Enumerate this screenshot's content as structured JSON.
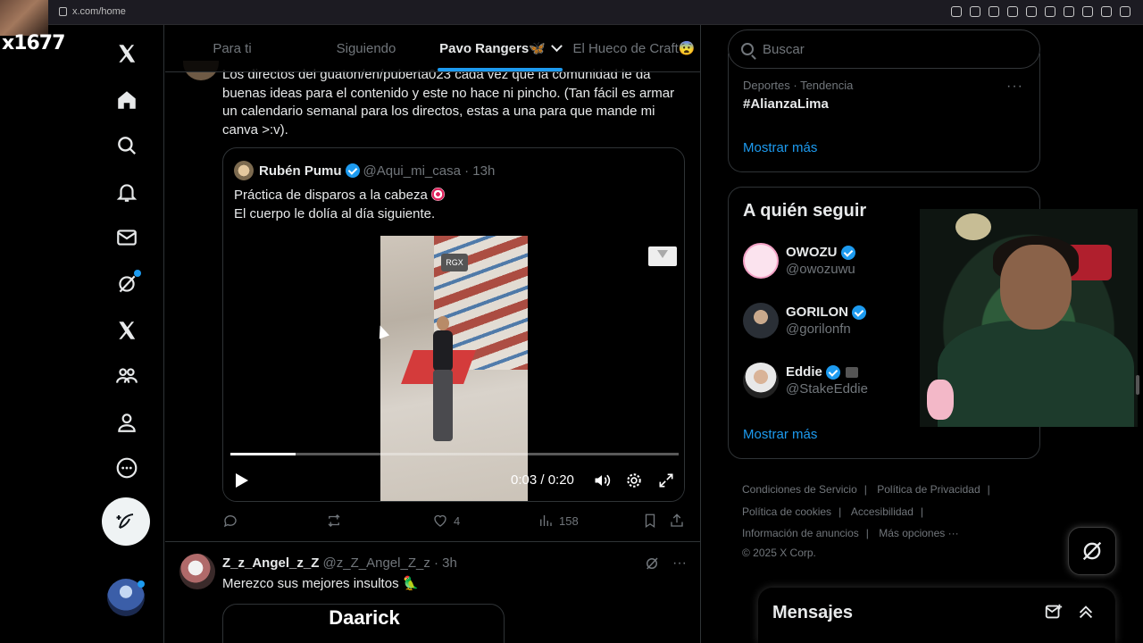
{
  "browser": {
    "url": "x.com/home"
  },
  "overlay": {
    "stream_text": "x1677"
  },
  "nav": {
    "items": [
      {
        "name": "x-logo-icon"
      },
      {
        "name": "home-icon"
      },
      {
        "name": "search-icon"
      },
      {
        "name": "bell-icon"
      },
      {
        "name": "mail-icon"
      },
      {
        "name": "grok-icon"
      },
      {
        "name": "x-premium-icon"
      },
      {
        "name": "communities-icon"
      },
      {
        "name": "profile-icon"
      },
      {
        "name": "more-icon"
      }
    ]
  },
  "tabs": [
    {
      "label": "Para ti",
      "active": false
    },
    {
      "label": "Siguiendo",
      "active": false
    },
    {
      "label": "Pavo Rangers🦋",
      "active": true
    },
    {
      "label": "El Hueco de Craft😨",
      "active": false
    }
  ],
  "tweet": {
    "text_top": "Los directos del guaton/en/puberta023 cada vez que la comunidad le da buenas ideas para el contenido y este no hace ni pincho. (Tan fácil es armar un calendario semanal para los directos, estas a una para que mande mi canva >:v).",
    "quote": {
      "name": "Rubén Pumu",
      "handle_time": "@Aqui_mi_casa · 13h",
      "line1": "Práctica de disparos a la cabeza",
      "line2": "El cuerpo le dolía al día siguiente.",
      "video": {
        "badge": "RGX",
        "time": "0:03 / 0:20",
        "progress": 0.145
      }
    },
    "actions": {
      "replies": "",
      "retweets": "",
      "likes": "4",
      "views": "158"
    }
  },
  "tweet2": {
    "name": "Z_z_Angel_z_Z",
    "handle_time": "@z_Z_Angel_Z_z · 3h",
    "text": "Merezco sus mejores insultos 🦜",
    "media_title": "Daarick"
  },
  "right": {
    "search_placeholder": "Buscar",
    "trend": {
      "meta": "Deportes · Tendencia",
      "name": "#AlianzaLima",
      "show_more": "Mostrar más"
    },
    "follow": {
      "title": "A quién seguir",
      "accounts": [
        {
          "name": "OWOZU",
          "handle": "@owozuwu",
          "color": "#f7d7e6"
        },
        {
          "name": "GORILON",
          "handle": "@gorilonfn",
          "color": "#3a3f47"
        },
        {
          "name": "Eddie",
          "handle": "@StakeEddie",
          "color": "#c9c9c9"
        }
      ],
      "show_more": "Mostrar más"
    },
    "footer": {
      "links": [
        "Condiciones de Servicio",
        "Política de Privacidad",
        "Política de cookies",
        "Accesibilidad",
        "Información de anuncios",
        "Más opciones ···"
      ],
      "copyright": "© 2025 X Corp."
    },
    "messages": {
      "title": "Mensajes"
    }
  },
  "colors": {
    "accent": "#1d9bf0",
    "background": "#000000",
    "border": "#2f3336",
    "muted": "#71767b"
  }
}
